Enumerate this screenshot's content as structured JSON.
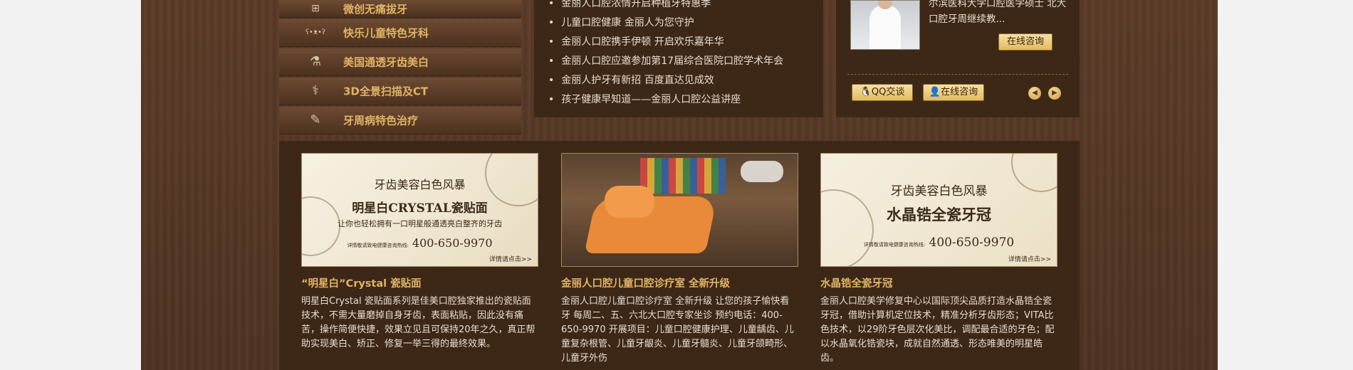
{
  "menu": {
    "items": [
      {
        "label": "微创无痛拔牙",
        "icon": "tooth-plus-icon",
        "glyph": "⊞"
      },
      {
        "label": "快乐儿童特色牙科",
        "icon": "bear-icon",
        "glyph": "ʕ•ᴥ•ʔ"
      },
      {
        "label": "美国通透牙齿美白",
        "icon": "microscope-icon",
        "glyph": "⚗"
      },
      {
        "label": "3D全景扫描及CT",
        "icon": "syringe-icon",
        "glyph": "⚕"
      },
      {
        "label": "牙周病特色治疗",
        "icon": "dental-tool-icon",
        "glyph": "✎"
      }
    ]
  },
  "news": {
    "items": [
      "金丽人口腔浓情开启种植牙特惠季",
      "儿童口腔健康 金丽人为您守护",
      "金丽人口腔携手伊顿 开启欢乐嘉年华",
      "金丽人口腔应邀参加第17届综合医院口腔学术年会",
      "金丽人护牙有新招 百度直达见成效",
      "孩子健康早知道——金丽人口腔公益讲座"
    ]
  },
  "expert": {
    "bio": "尔滨医科大学口腔医学硕士 北大口腔牙周继续教...",
    "consult_label": "在线咨询",
    "qq_label": "QQ交谈",
    "online_label": "在线咨询"
  },
  "features": [
    {
      "ad_line1": "牙齿美容白色风暴",
      "ad_line2": "明星白CRYSTAL瓷贴面",
      "ad_line3": "让你也轻松拥有一口明星般通透亮白整齐的牙齿",
      "ad_phone_label": "详情敬请致电健康咨询热线:",
      "ad_phone": "400-650-9970",
      "ad_more": "详情请点击>>",
      "title": "“明星白”Crystal 瓷贴面",
      "desc": "明星白Crystal 瓷贴面系列是佳美口腔独家推出的瓷贴面技术，不需大量磨掉自身牙齿，表面粘贴，因此没有痛苦，操作简便快捷，效果立见且可保持20年之久，真正帮助实现美白、矫正、修复一举三得的最终效果。"
    },
    {
      "title": "金丽人口腔儿童口腔诊疗室 全新升级",
      "desc": "金丽人口腔儿童口腔诊疗室 全新升级 让您的孩子愉快看牙 每周二、五、六北大口腔专家坐诊 预约电话：400-650-9970 开展项目：儿童口腔健康护理、儿童龋齿、儿童复杂根管、儿童牙龈炎、儿童牙髓炎、儿童牙颌畸形、儿童牙外伤"
    },
    {
      "ad_line1": "牙齿美容白色风暴",
      "ad_line2": "水晶锆全瓷牙冠",
      "ad_phone_label": "详情敬请致电健康咨询热线:",
      "ad_phone": "400-650-9970",
      "ad_more": "详情请点击>>",
      "title": "水晶锆全瓷牙冠",
      "desc": "金丽人口腔美学修复中心以国际顶尖品质打造水晶锆全瓷牙冠，借助计算机定位技术，精准分析牙齿形态；VITA比色技术，以29阶牙色层次化美比，调配最合适的牙色；配以水晶氧化锆瓷块，成就自然通透、形态唯美的明星皓齿。"
    }
  ]
}
